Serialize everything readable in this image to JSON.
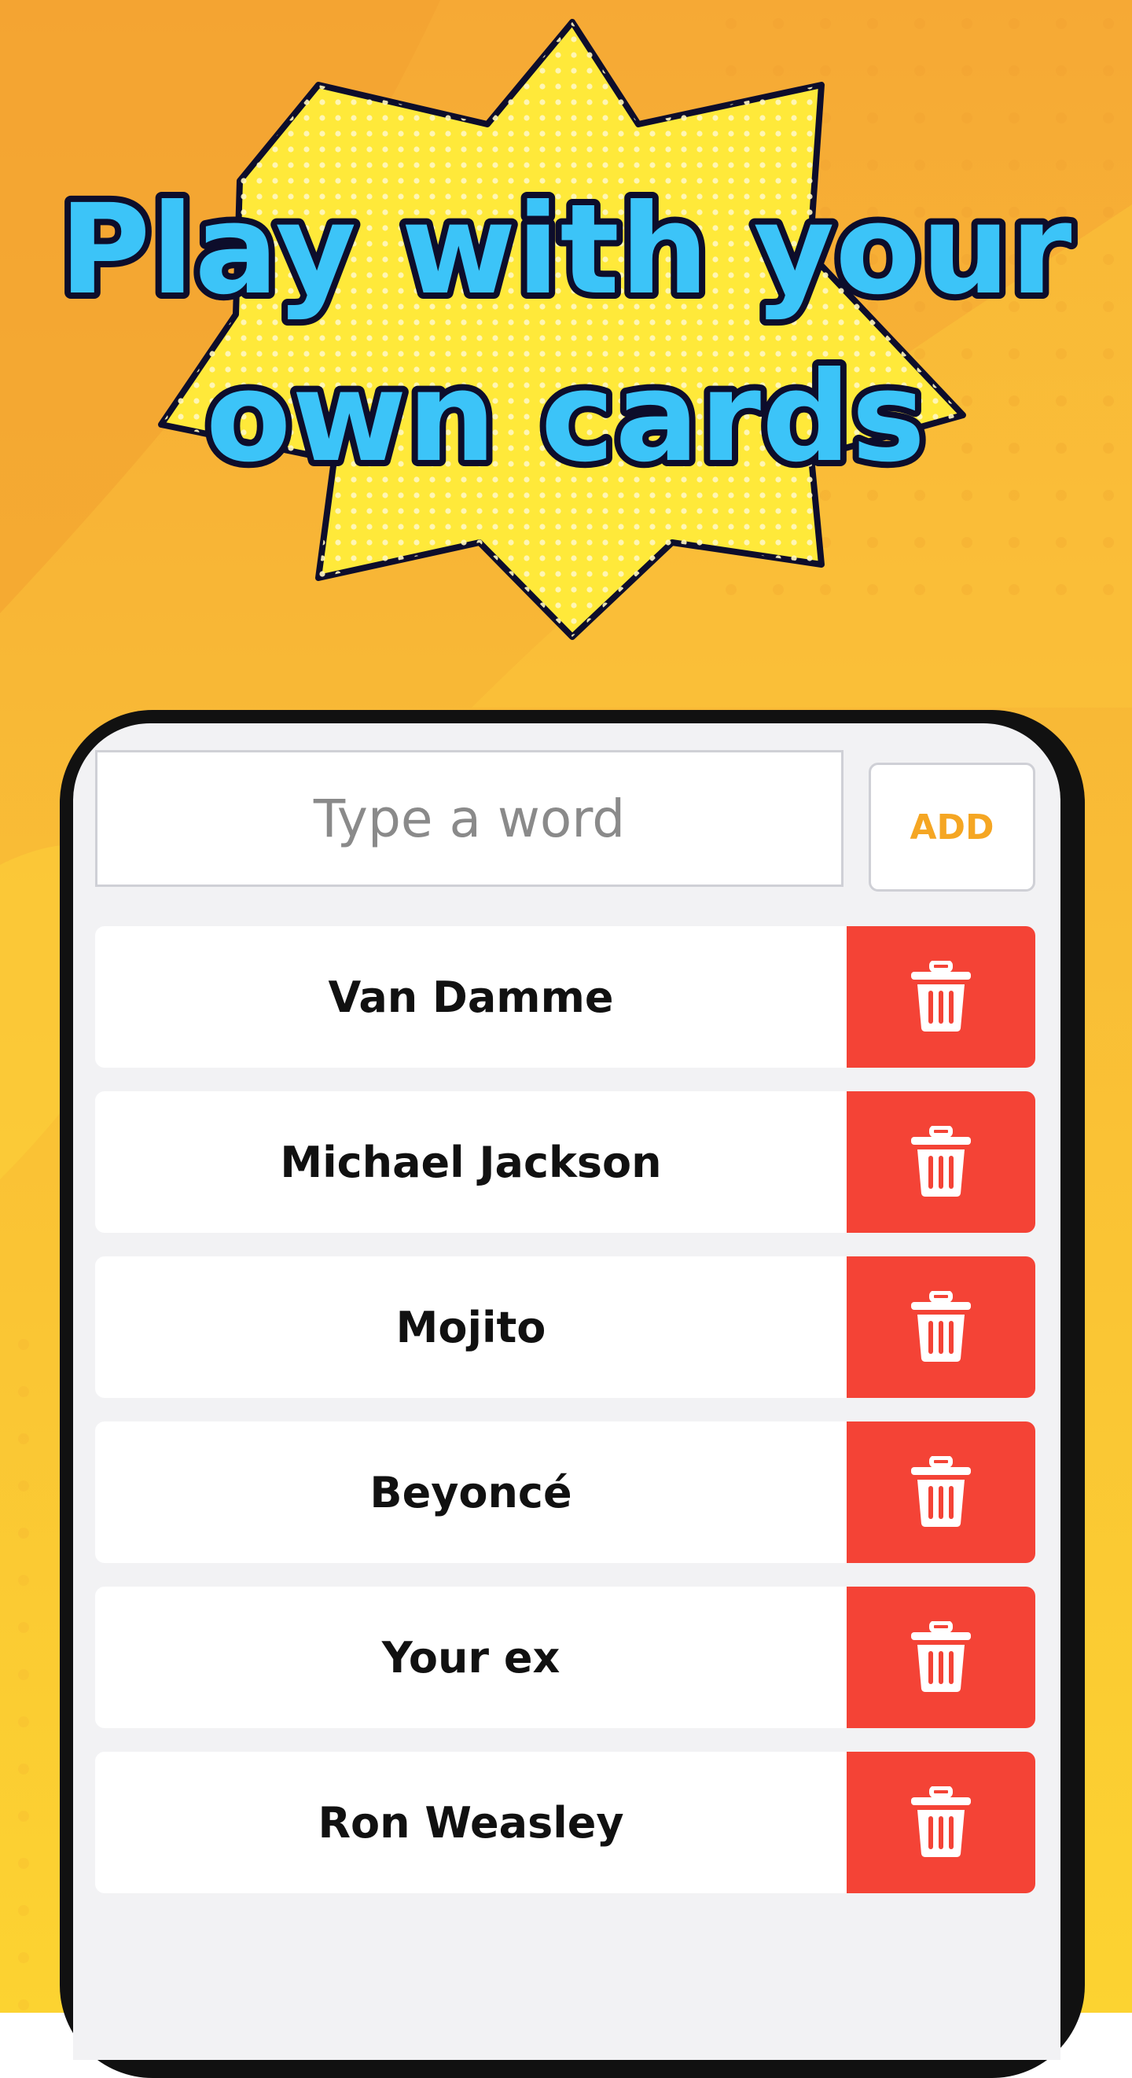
{
  "headline": {
    "line1": "Play with your",
    "line2": "own cards"
  },
  "colors": {
    "background_top": "#f6a935",
    "background_bottom": "#fcd331",
    "burst_fill": "#ffe93a",
    "headline_text": "#3cc4f8",
    "headline_outline": "#0d0d2b",
    "add_text": "#f5a623",
    "delete_background": "#f44336"
  },
  "input": {
    "placeholder": "Type a word",
    "value": ""
  },
  "add_button": {
    "label": "ADD"
  },
  "cards": [
    {
      "label": "Van Damme",
      "delete_icon": "trash-icon"
    },
    {
      "label": "Michael Jackson",
      "delete_icon": "trash-icon"
    },
    {
      "label": "Mojito",
      "delete_icon": "trash-icon"
    },
    {
      "label": "Beyoncé",
      "delete_icon": "trash-icon"
    },
    {
      "label": "Your ex",
      "delete_icon": "trash-icon"
    },
    {
      "label": "Ron Weasley",
      "delete_icon": "trash-icon"
    }
  ]
}
